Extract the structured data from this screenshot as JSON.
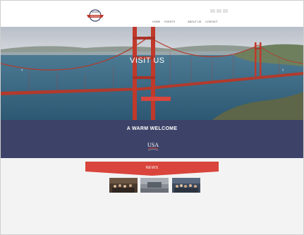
{
  "header": {
    "logo_icon": "brand-logo-icon",
    "languages": [
      "",
      "",
      ""
    ],
    "nav": [
      "HOME",
      "EVENTS",
      "",
      "",
      "ABOUT US",
      "CONTACT"
    ]
  },
  "hero": {
    "title": "VISIT US",
    "button_label": "",
    "prev_icon": "chevron-left-icon",
    "next_icon": "chevron-right-icon"
  },
  "welcome": {
    "title": "A WARM WELCOME",
    "text": "",
    "partner_logo": "USA"
  },
  "news": {
    "title": "NEWS",
    "items": [
      {
        "date": "",
        "title": "",
        "excerpt": "",
        "more": ""
      },
      {
        "date": "",
        "title": "",
        "excerpt": "",
        "more": ""
      },
      {
        "date": "",
        "title": "",
        "excerpt": "",
        "more": ""
      }
    ]
  },
  "colors": {
    "accent": "#d9453c",
    "welcome_bg": "#3d4368",
    "sky": "#c9ced6",
    "water": "#3f6f8c",
    "bridge": "#c0392b"
  }
}
